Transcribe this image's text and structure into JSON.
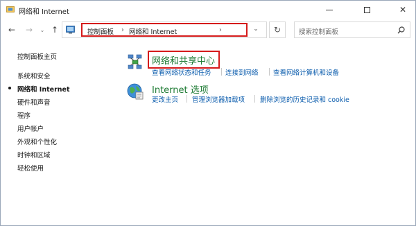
{
  "window": {
    "title": "网络和 Internet",
    "controls": {
      "minimize": "—",
      "maximize": "☐",
      "close": "✕"
    }
  },
  "nav": {
    "back": "←",
    "forward": "→",
    "recent": "⌄",
    "up": "↑"
  },
  "address": {
    "crumbs": [
      "控制面板",
      "网络和 Internet"
    ],
    "separator": "›",
    "dropdown": "⌄",
    "refresh": "↻"
  },
  "search": {
    "placeholder": "搜索控制面板"
  },
  "sidebar": {
    "items": [
      {
        "label": "控制面板主页"
      },
      {
        "label": "系统和安全"
      },
      {
        "label": "网络和 Internet",
        "active": true
      },
      {
        "label": "硬件和声音"
      },
      {
        "label": "程序"
      },
      {
        "label": "用户帐户"
      },
      {
        "label": "外观和个性化"
      },
      {
        "label": "时钟和区域"
      },
      {
        "label": "轻松使用"
      }
    ]
  },
  "categories": [
    {
      "title": "网络和共享中心",
      "icon": "network-sharing-icon",
      "links": [
        "查看网络状态和任务",
        "连接到网络",
        "查看网络计算机和设备"
      ]
    },
    {
      "title": "Internet 选项",
      "icon": "internet-options-icon",
      "links": [
        "更改主页",
        "管理浏览器加载项",
        "删除浏览的历史记录和 cookie"
      ]
    }
  ],
  "colors": {
    "highlight": "#d51b1b",
    "category": "#1e7b34",
    "link": "#0b5cad"
  }
}
